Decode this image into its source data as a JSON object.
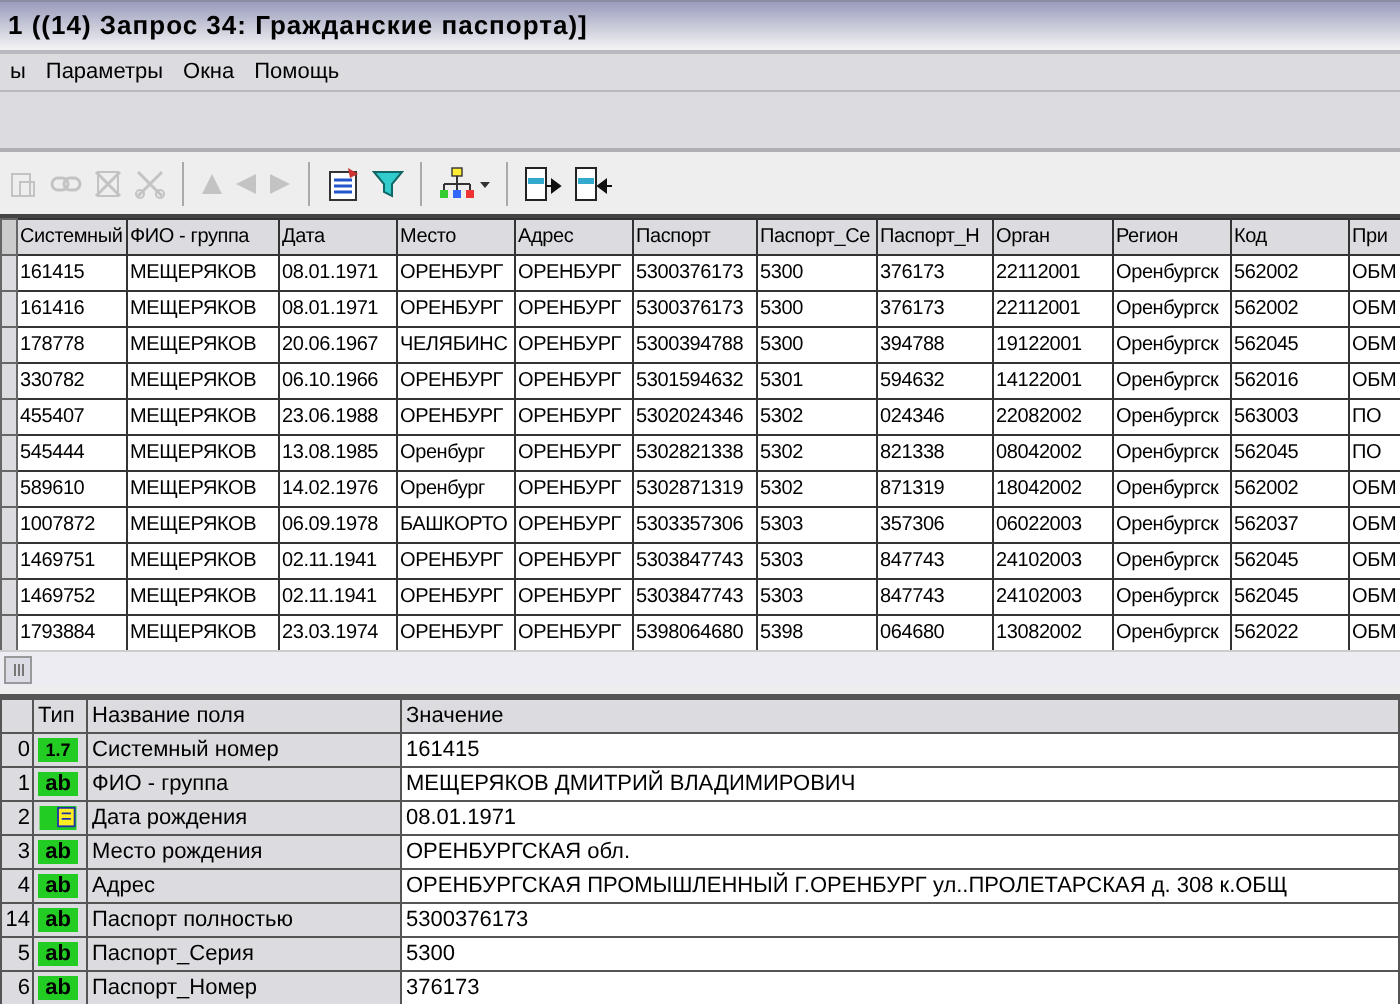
{
  "window": {
    "title": "1 ((14) Запрос 34: Гражданские паспорта)]"
  },
  "menu": [
    "ы",
    "Параметры",
    "Окна",
    "Помощь"
  ],
  "toolbar": [
    {
      "kind": "paste",
      "disabled": true
    },
    {
      "kind": "link",
      "disabled": true
    },
    {
      "kind": "delete",
      "disabled": true
    },
    {
      "kind": "cut",
      "disabled": true
    },
    {
      "kind": "sep"
    },
    {
      "kind": "up",
      "disabled": true
    },
    {
      "kind": "left",
      "disabled": true
    },
    {
      "kind": "right",
      "disabled": true
    },
    {
      "kind": "sep"
    },
    {
      "kind": "report",
      "disabled": false
    },
    {
      "kind": "filter",
      "disabled": false
    },
    {
      "kind": "sep"
    },
    {
      "kind": "tree",
      "disabled": false
    },
    {
      "kind": "sep"
    },
    {
      "kind": "export",
      "disabled": false
    },
    {
      "kind": "import",
      "disabled": false
    }
  ],
  "table": {
    "columns": [
      "Системный",
      "ФИО - группа",
      "Дата",
      "Место",
      "Адрес",
      "Паспорт",
      "Паспорт_Се",
      "Паспорт_Н",
      "Орган",
      "Регион",
      "Код",
      "При"
    ],
    "rows": [
      [
        "161415",
        "МЕЩЕРЯКОВ",
        "08.01.1971",
        "ОРЕНБУРГ",
        "ОРЕНБУРГ",
        "5300376173",
        "5300",
        "376173",
        "22112001",
        "Оренбургск",
        "562002",
        "ОБМ"
      ],
      [
        "161416",
        "МЕЩЕРЯКОВ",
        "08.01.1971",
        "ОРЕНБУРГ",
        "ОРЕНБУРГ",
        "5300376173",
        "5300",
        "376173",
        "22112001",
        "Оренбургск",
        "562002",
        "ОБМ"
      ],
      [
        "178778",
        "МЕЩЕРЯКОВ",
        "20.06.1967",
        "ЧЕЛЯБИНС",
        "ОРЕНБУРГ",
        "5300394788",
        "5300",
        "394788",
        "19122001",
        "Оренбургск",
        "562045",
        "ОБМ"
      ],
      [
        "330782",
        "МЕЩЕРЯКОВ",
        "06.10.1966",
        "ОРЕНБУРГ",
        "ОРЕНБУРГ",
        "5301594632",
        "5301",
        "594632",
        "14122001",
        "Оренбургск",
        "562016",
        "ОБМ"
      ],
      [
        "455407",
        "МЕЩЕРЯКОВ",
        "23.06.1988",
        "ОРЕНБУРГ",
        "ОРЕНБУРГ",
        "5302024346",
        "5302",
        "024346",
        "22082002",
        "Оренбургск",
        "563003",
        "ПО"
      ],
      [
        "545444",
        "МЕЩЕРЯКОВ",
        "13.08.1985",
        "Оренбург",
        "ОРЕНБУРГ",
        "5302821338",
        "5302",
        "821338",
        "08042002",
        "Оренбургск",
        "562045",
        "ПО"
      ],
      [
        "589610",
        "МЕЩЕРЯКОВ",
        "14.02.1976",
        "Оренбург",
        "ОРЕНБУРГ",
        "5302871319",
        "5302",
        "871319",
        "18042002",
        "Оренбургск",
        "562002",
        "ОБМ"
      ],
      [
        "1007872",
        "МЕЩЕРЯКОВ",
        "06.09.1978",
        "БАШКОРТО",
        "ОРЕНБУРГ",
        "5303357306",
        "5303",
        "357306",
        "06022003",
        "Оренбургск",
        "562037",
        "ОБМ"
      ],
      [
        "1469751",
        "МЕЩЕРЯКОВ",
        "02.11.1941",
        "ОРЕНБУРГ",
        "ОРЕНБУРГ",
        "5303847743",
        "5303",
        "847743",
        "24102003",
        "Оренбургск",
        "562045",
        "ОБМ"
      ],
      [
        "1469752",
        "МЕЩЕРЯКОВ",
        "02.11.1941",
        "ОРЕНБУРГ",
        "ОРЕНБУРГ",
        "5303847743",
        "5303",
        "847743",
        "24102003",
        "Оренбургск",
        "562045",
        "ОБМ"
      ],
      [
        "1793884",
        "МЕЩЕРЯКОВ",
        "23.03.1974",
        "ОРЕНБУРГ",
        "ОРЕНБУРГ",
        "5398064680",
        "5398",
        "064680",
        "13082002",
        "Оренбургск",
        "562022",
        "ОБМ"
      ]
    ]
  },
  "fields": {
    "columns": [
      "Тип",
      "Название поля",
      "Значение"
    ],
    "rows": [
      {
        "index": "0",
        "kind": "number",
        "type_label": "1.7",
        "name": "Системный номер",
        "value": "161415"
      },
      {
        "index": "1",
        "kind": "text",
        "type_label": "ab",
        "name": "ФИО - группа",
        "value": "МЕЩЕРЯКОВ ДМИТРИЙ ВЛАДИМИРОВИЧ"
      },
      {
        "index": "2",
        "kind": "date",
        "name": "Дата рождения",
        "value": "08.01.1971"
      },
      {
        "index": "3",
        "kind": "text",
        "type_label": "ab",
        "name": "Место рождения",
        "value": "ОРЕНБУРГСКАЯ обл."
      },
      {
        "index": "4",
        "kind": "text",
        "type_label": "ab",
        "name": "Адрес",
        "value": "ОРЕНБУРГСКАЯ ПРОМЫШЛЕННЫЙ Г.ОРЕНБУРГ ул..ПРОЛЕТАРСКАЯ д. 308 к.ОБЩ"
      },
      {
        "index": "14",
        "kind": "text",
        "type_label": "ab",
        "name": "Паспорт полностью",
        "value": "5300376173"
      },
      {
        "index": "5",
        "kind": "text",
        "type_label": "ab",
        "name": "Паспорт_Серия",
        "value": "5300"
      },
      {
        "index": "6",
        "kind": "text",
        "type_label": "ab",
        "name": "Паспорт_Номер",
        "value": "376173"
      }
    ]
  }
}
